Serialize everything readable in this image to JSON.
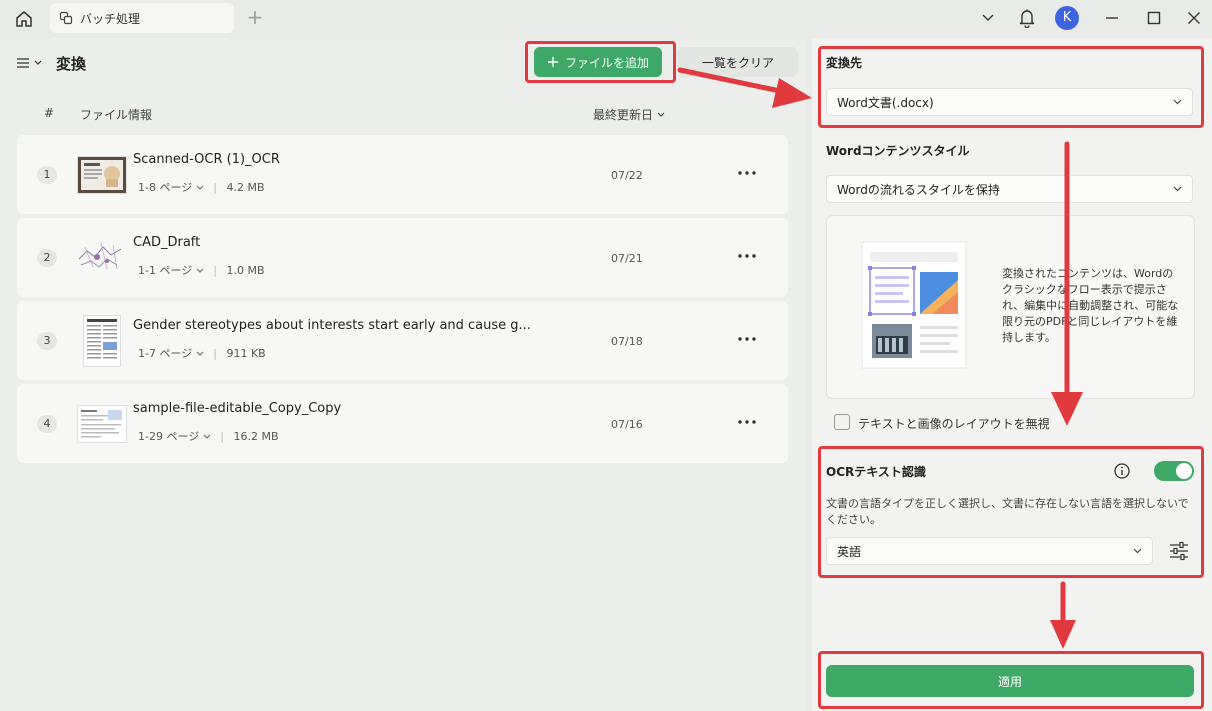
{
  "titlebar": {
    "tab_label": "バッチ処理",
    "avatar_initial": "K"
  },
  "toolbar": {
    "title": "変換",
    "add_file_label": "ファイルを追加",
    "clear_list_label": "一覧をクリア"
  },
  "table": {
    "columns": [
      "#",
      "ファイル情報",
      "最終更新日"
    ],
    "rows": [
      {
        "num": "1",
        "name": "Scanned-OCR (1)_OCR",
        "pages": "1-8 ページ",
        "size": "4.2 MB",
        "date": "07/22"
      },
      {
        "num": "2",
        "name": "CAD_Draft",
        "pages": "1-1 ページ",
        "size": "1.0 MB",
        "date": "07/21"
      },
      {
        "num": "3",
        "name": "Gender stereotypes about interests start early and cause g...",
        "pages": "1-7 ページ",
        "size": "911 KB",
        "date": "07/18"
      },
      {
        "num": "4",
        "name": "sample-file-editable_Copy_Copy",
        "pages": "1-29 ページ",
        "size": "16.2 MB",
        "date": "07/16"
      }
    ]
  },
  "settings": {
    "target_title": "変換先",
    "target_value": "Word文書(.docx)",
    "style_title": "Wordコンテンツスタイル",
    "style_value": "Wordの流れるスタイルを保持",
    "style_description": "変換されたコンテンツは、Wordのクラシックなフロー表示で提示され、編集中に自動調整され、可能な限り元のPDFと同じレイアウトを維持します。",
    "ignore_layout_label": "テキストと画像のレイアウトを無視",
    "ocr_title": "OCRテキスト認識",
    "ocr_description": "文書の言語タイプを正しく選択し、文書に存在しない言語を選択しないでください。",
    "ocr_language": "英語",
    "ocr_enabled": true,
    "apply_label": "適用"
  },
  "colors": {
    "accent": "#3ea867",
    "highlight": "#e0393e",
    "avatar": "#3d63e0"
  }
}
